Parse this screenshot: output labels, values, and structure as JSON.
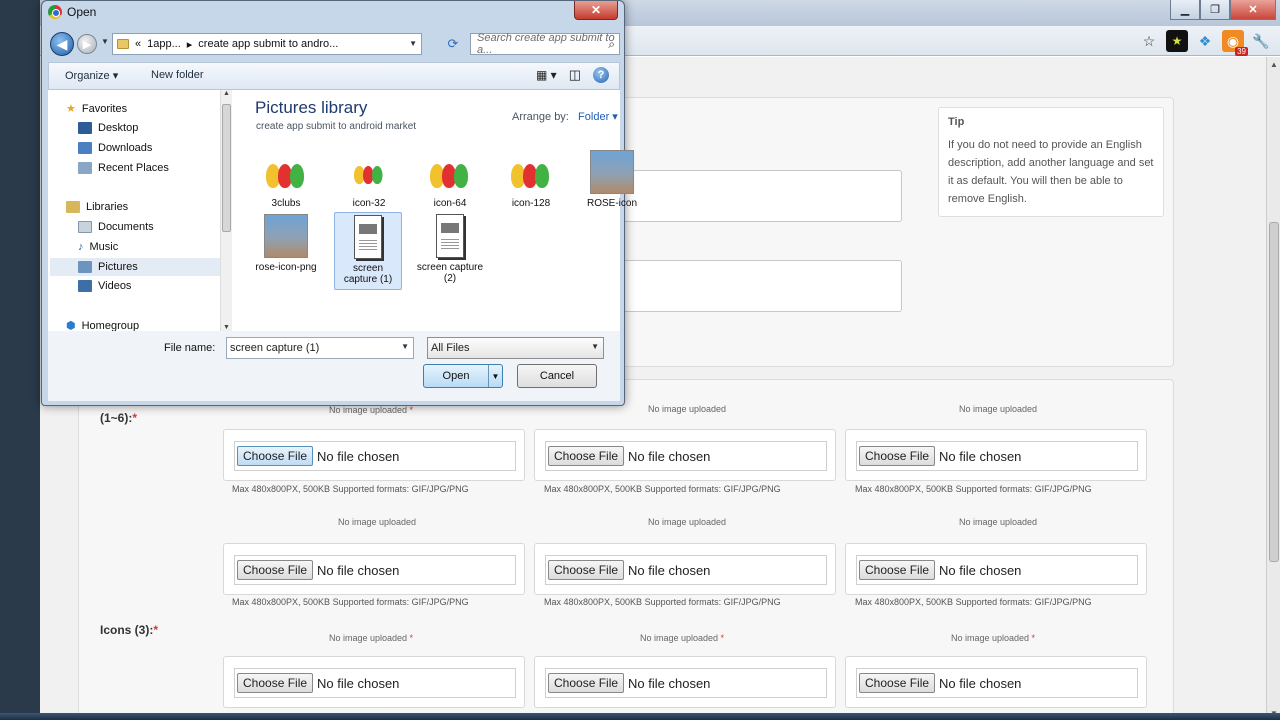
{
  "dialog": {
    "title": "Open",
    "close_glyph": "✕",
    "address": {
      "prefix": "«",
      "crumbs": [
        "1app...",
        "create app submit to andro..."
      ]
    },
    "search_placeholder": "Search create app submit to a...",
    "toolbar": {
      "organize": "Organize",
      "new_folder": "New folder"
    },
    "nav": {
      "favorites": "Favorites",
      "desktop": "Desktop",
      "downloads": "Downloads",
      "recent_places": "Recent Places",
      "libraries": "Libraries",
      "documents": "Documents",
      "music": "Music",
      "pictures": "Pictures",
      "videos": "Videos",
      "homegroup": "Homegroup"
    },
    "library": {
      "title": "Pictures library",
      "subtitle": "create app submit to android market",
      "arrange_label": "Arrange by:",
      "arrange_value": "Folder"
    },
    "files": [
      {
        "name": "3clubs",
        "kind": "fruit"
      },
      {
        "name": "icon-32",
        "kind": "fruit"
      },
      {
        "name": "icon-64",
        "kind": "fruit"
      },
      {
        "name": "icon-128",
        "kind": "fruit"
      },
      {
        "name": "ROSE-icon",
        "kind": "photo"
      },
      {
        "name": "rose-icon-png",
        "kind": "photo"
      },
      {
        "name": "screen capture (1)",
        "kind": "doc",
        "selected": true
      },
      {
        "name": "screen capture (2)",
        "kind": "doc"
      }
    ],
    "file_name_label": "File name:",
    "file_name_value": "screen capture (1)",
    "file_type_value": "All Files",
    "open_button": "Open",
    "cancel_button": "Cancel"
  },
  "browser": {
    "tip": {
      "title": "Tip",
      "text": "If you do not need to provide an English description, add another language and set it as default. You will then be able to remove English."
    },
    "badge_count": "39",
    "screenshots_label": "(1~6):",
    "icons_label": "Icons (3):",
    "no_image": "No image uploaded",
    "choose_file": "Choose File",
    "no_file": "No file chosen",
    "formats": "Max 480x800PX, 500KB Supported formats: GIF/JPG/PNG"
  },
  "colors": {
    "accent": "#1e5fb0",
    "required": "#dd3333",
    "dialog_frame": "#c6d7ea"
  }
}
